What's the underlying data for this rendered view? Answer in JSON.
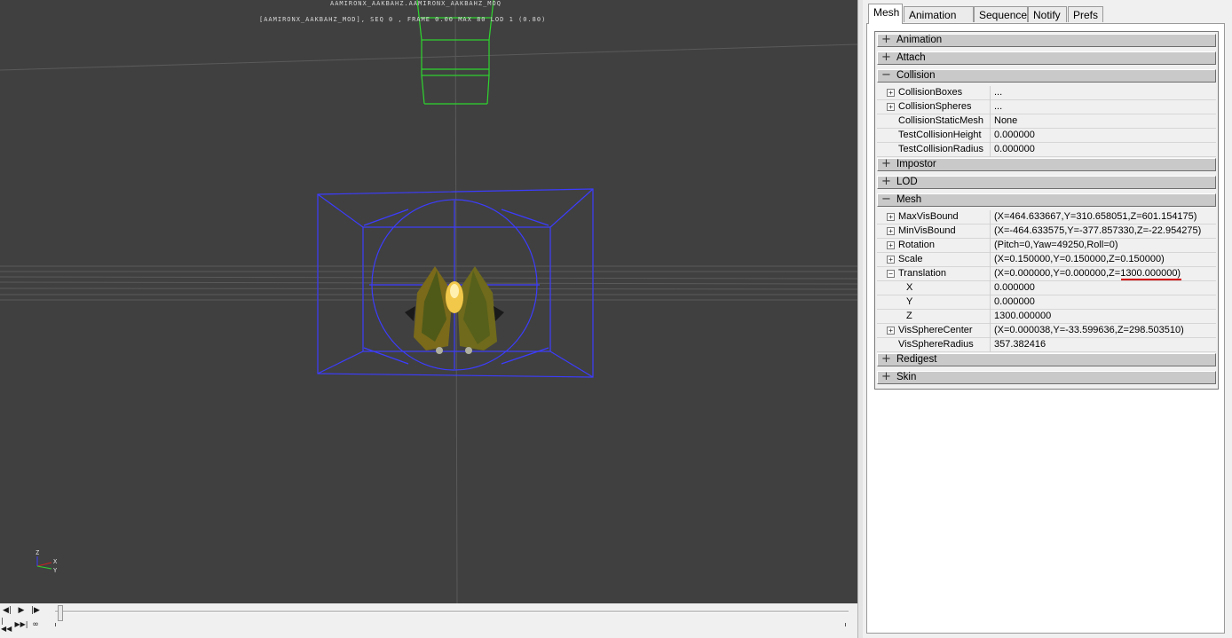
{
  "viewport": {
    "hud_line1": "AAMIRONX_AAKBAHZ.AAMIRONX_AAKBAHZ_MOQ",
    "hud_line2": "[AAMIRONX_AAKBAHZ_MOD], SEQ 0 , FRAME  0.00 MAX 80  LOD 1 (0.80)",
    "axis_z": "Z",
    "axis_x": "X",
    "axis_y": "Y",
    "colors": {
      "background": "#404040",
      "bounds_wire": "#3c3cff",
      "collision_wire": "#2ed52e"
    }
  },
  "playback": {
    "prev_icon": "◀|",
    "play_icon": "▶",
    "next_icon": "|▶",
    "first_icon": "|◀◀",
    "last_icon": "▶▶|",
    "loop_icon": "∞",
    "position": 0.0
  },
  "tabs": [
    {
      "label": "Mesh",
      "active": true
    },
    {
      "label": "Animation Set",
      "active": false
    },
    {
      "label": "Sequence",
      "active": false
    },
    {
      "label": "Notify",
      "active": false
    },
    {
      "label": "Prefs",
      "active": false
    }
  ],
  "property_grid": {
    "categories": {
      "animation": {
        "label": "Animation",
        "sign": "+"
      },
      "attach": {
        "label": "Attach",
        "sign": "+"
      },
      "collision": {
        "label": "Collision",
        "sign": "−"
      },
      "impostor": {
        "label": "Impostor",
        "sign": "+"
      },
      "lod": {
        "label": "LOD",
        "sign": "+"
      },
      "mesh": {
        "label": "Mesh",
        "sign": "−"
      },
      "redigest": {
        "label": "Redigest",
        "sign": "+"
      },
      "skin": {
        "label": "Skin",
        "sign": "+"
      }
    },
    "collision": [
      {
        "name": "CollisionBoxes",
        "value": "...",
        "expander": "+"
      },
      {
        "name": "CollisionSpheres",
        "value": "...",
        "expander": "+"
      },
      {
        "name": "CollisionStaticMesh",
        "value": "None",
        "expander": ""
      },
      {
        "name": "TestCollisionHeight",
        "value": "0.000000",
        "expander": ""
      },
      {
        "name": "TestCollisionRadius",
        "value": "0.000000",
        "expander": ""
      }
    ],
    "mesh": [
      {
        "name": "MaxVisBound",
        "value": "(X=464.633667,Y=310.658051,Z=601.154175)",
        "expander": "+"
      },
      {
        "name": "MinVisBound",
        "value": "(X=-464.633575,Y=-377.857330,Z=-22.954275)",
        "expander": "+"
      },
      {
        "name": "Rotation",
        "value": "(Pitch=0,Yaw=49250,Roll=0)",
        "expander": "+"
      },
      {
        "name": "Scale",
        "value": "(X=0.150000,Y=0.150000,Z=0.150000)",
        "expander": "+"
      },
      {
        "name": "Translation",
        "value": "(X=0.000000,Y=0.000000,Z=1300.000000)",
        "expander": "−"
      },
      {
        "name": "X",
        "value": "0.000000",
        "expander": ""
      },
      {
        "name": "Y",
        "value": "0.000000",
        "expander": ""
      },
      {
        "name": "Z",
        "value": "1300.000000",
        "expander": ""
      },
      {
        "name": "VisSphereCenter",
        "value": "(X=0.000038,Y=-33.599636,Z=298.503510)",
        "expander": "+"
      },
      {
        "name": "VisSphereRadius",
        "value": "357.382416",
        "expander": ""
      }
    ],
    "highlight_color": "#d40000"
  }
}
